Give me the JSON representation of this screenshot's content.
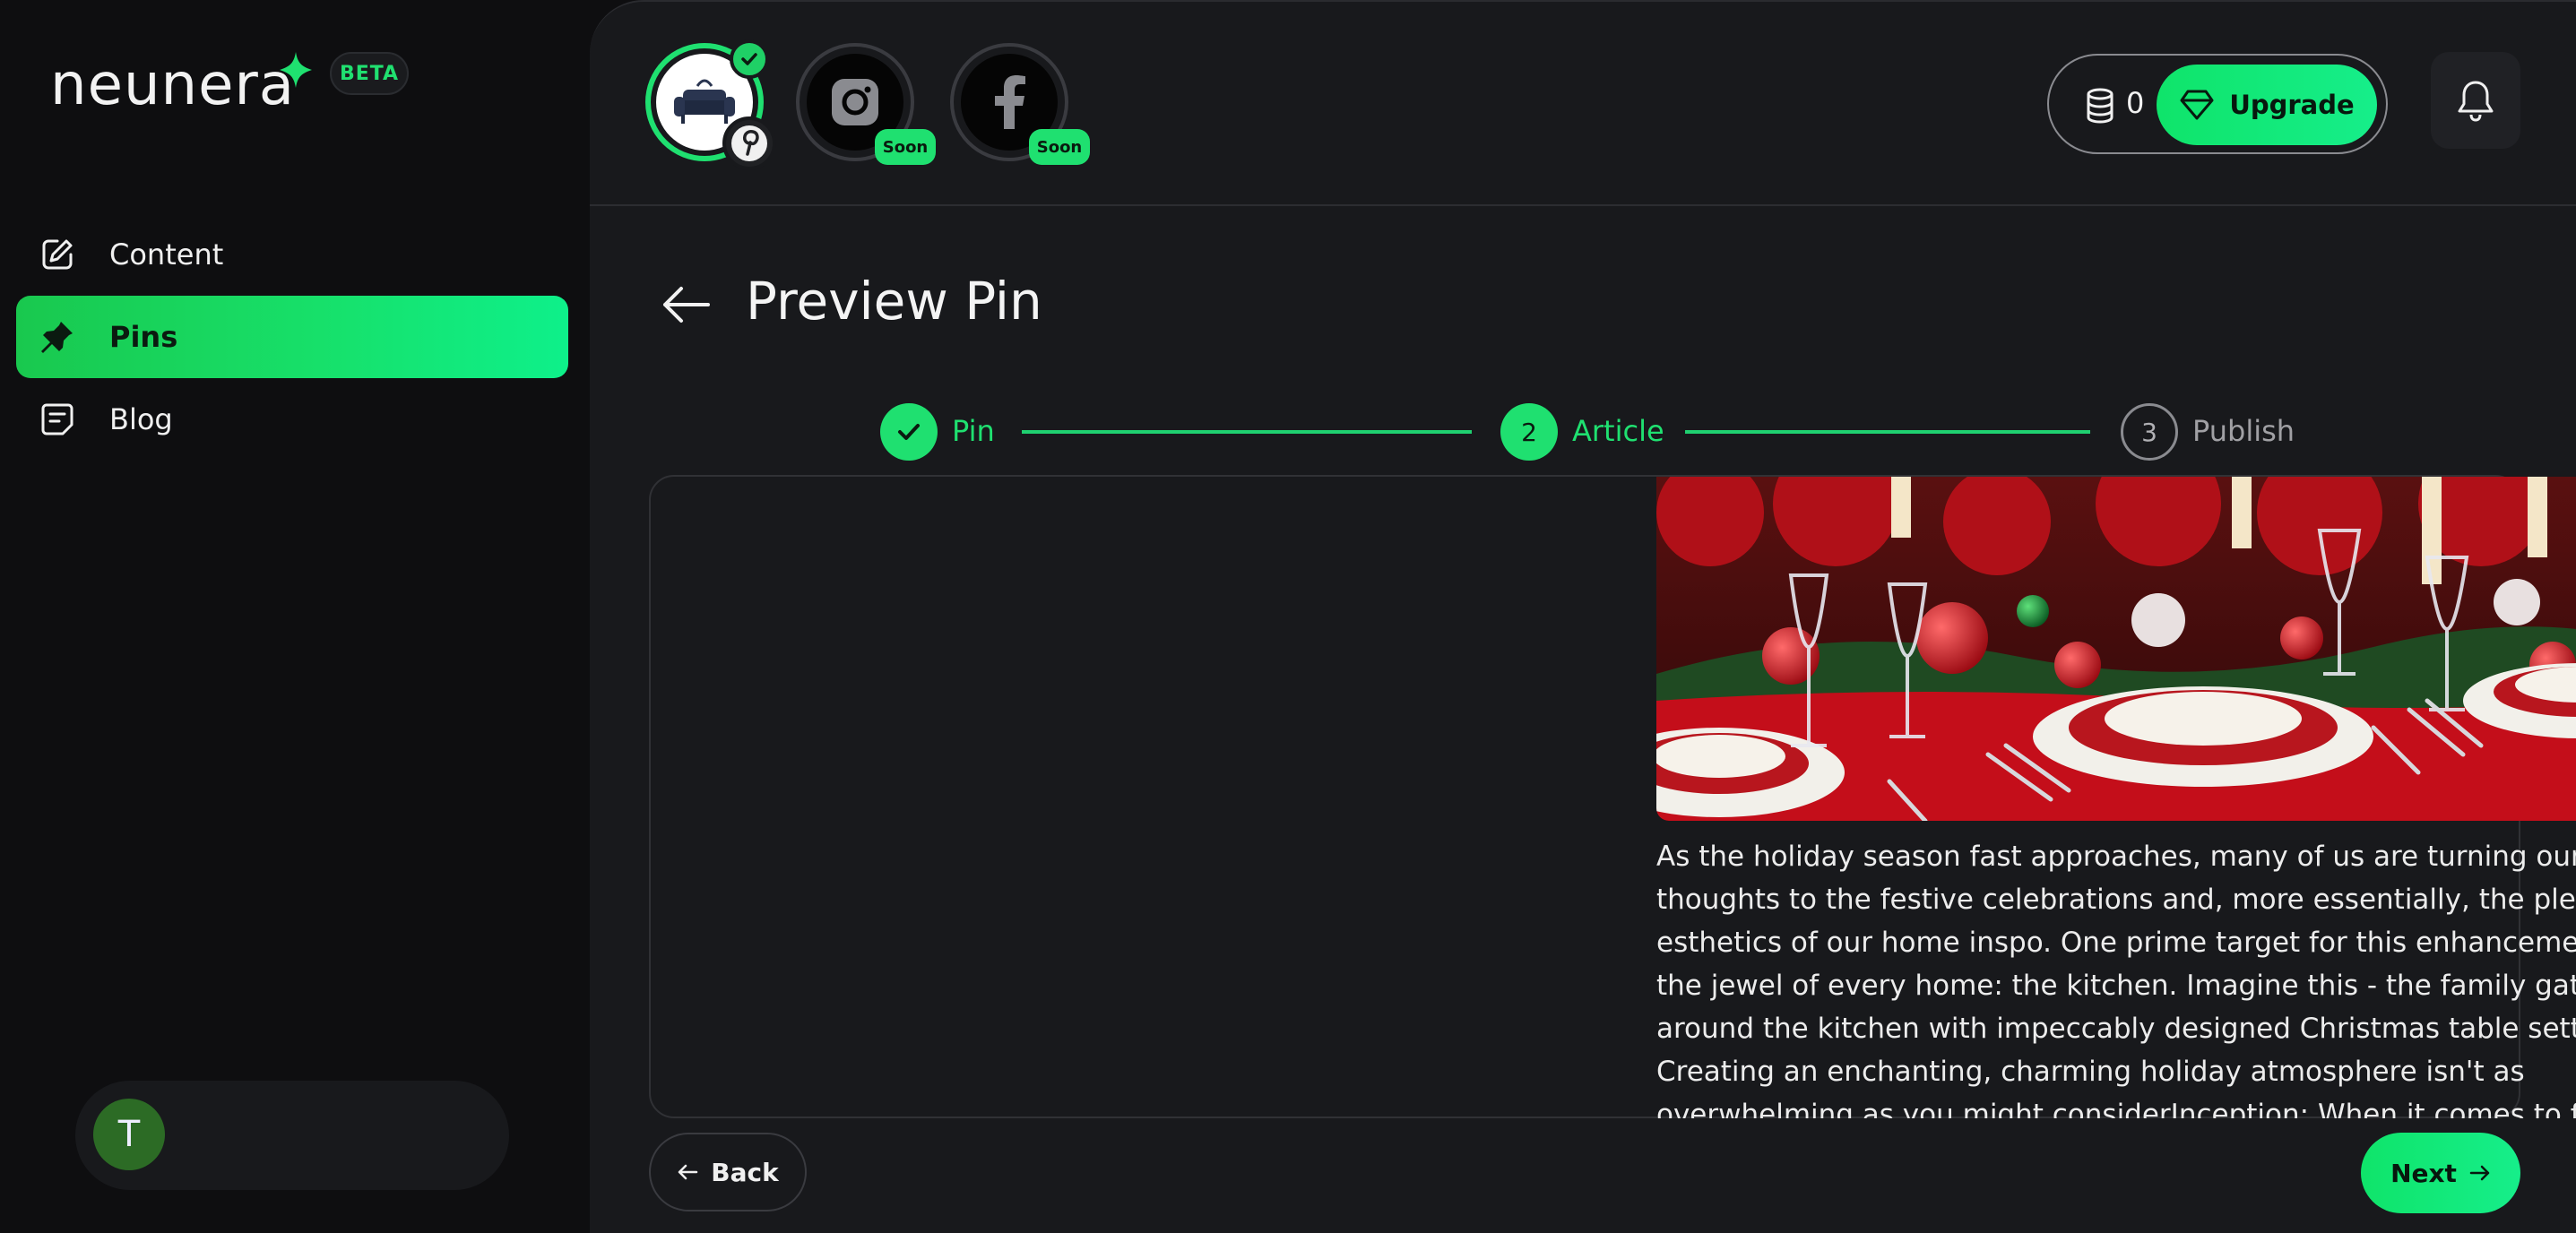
{
  "brand": {
    "name": "neunera",
    "badge": "BETA"
  },
  "sidebar": {
    "items": [
      {
        "label": "Content",
        "icon": "edit-icon",
        "active": false
      },
      {
        "label": "Pins",
        "icon": "pin-icon",
        "active": true
      },
      {
        "label": "Blog",
        "icon": "document-icon",
        "active": false
      }
    ],
    "user": {
      "initial": "T"
    }
  },
  "accounts": [
    {
      "platform": "pinterest",
      "status": "connected"
    },
    {
      "platform": "instagram",
      "badge": "Soon"
    },
    {
      "platform": "facebook",
      "badge": "Soon"
    }
  ],
  "header": {
    "credits": "0",
    "upgrade_label": "Upgrade"
  },
  "page": {
    "title": "Preview Pin"
  },
  "stepper": {
    "steps": [
      {
        "number": "1",
        "label": "Pin",
        "state": "done"
      },
      {
        "number": "2",
        "label": "Article",
        "state": "current"
      },
      {
        "number": "3",
        "label": "Publish",
        "state": "upcoming"
      }
    ]
  },
  "article": {
    "text": "As the holiday season fast approaches, many of us are turning our thoughts to the festive celebrations and, more essentially, the pleasing esthetics of our home inspo. One prime target for this enhancement is the jewel of every home: the kitchen. Imagine this - the family gathering around the kitchen with impeccably designed Christmas table settings. Creating an enchanting, charming holiday atmosphere isn't as overwhelming as you might considerInception: When it comes to finding home inspo for your Christmas"
  },
  "footer": {
    "back_label": "Back",
    "next_label": "Next"
  },
  "colors": {
    "accent": "#1fe070",
    "background": "#0e0e10",
    "panel": "#18191c"
  }
}
